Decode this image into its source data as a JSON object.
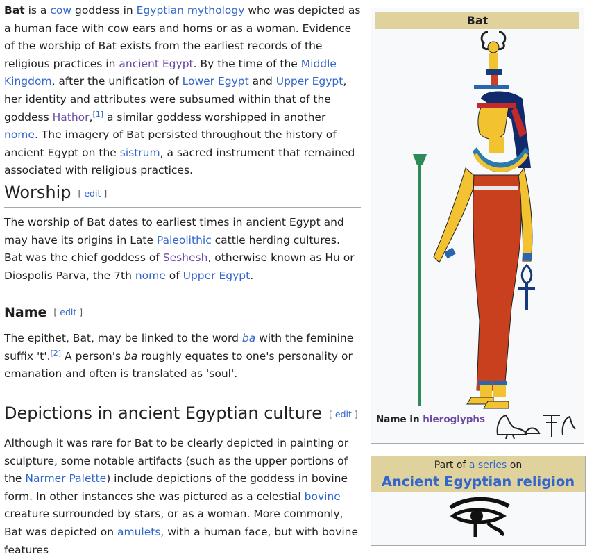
{
  "intro": {
    "t1_bold": "Bat",
    "t2": " is a ",
    "l_cow": "cow",
    "t3": " goddess in ",
    "l_mythology": "Egyptian mythology",
    "t4": " who was depicted as a human face with cow ears and horns or as a woman. Evidence of the worship of Bat exists from the earliest records of the religious practices in ",
    "l_ancient": "ancient Egypt",
    "t5": ". By the time of the ",
    "l_middle": "Middle Kingdom",
    "t6": ", after the unification of ",
    "l_lower": "Lower Egypt",
    "t7": " and ",
    "l_upper": "Upper Egypt",
    "t8": ", her identity and attributes were subsumed within that of the goddess ",
    "l_hathor": "Hathor",
    "t8b": ",",
    "ref1": "[1]",
    "t9": " a similar goddess worshipped in another ",
    "l_nome": "nome",
    "t10": ". The imagery of Bat persisted throughout the history of ancient Egypt on the ",
    "l_sistrum": "sistrum",
    "t11": ", a sacred instrument that remained associated with religious practices."
  },
  "worship": {
    "heading": "Worship",
    "edit_open": "[ ",
    "edit": "edit",
    "edit_close": " ]",
    "t1": "The worship of Bat dates to earliest times in ancient Egypt and may have its origins in Late ",
    "l_paleolithic": "Paleolithic",
    "t2": " cattle herding cultures. Bat was the chief goddess of ",
    "l_seshesh": "Seshesh",
    "t3": ", otherwise known as Hu or Diospolis Parva, the 7th ",
    "l_nome": "nome",
    "t4": " of ",
    "l_upper": "Upper Egypt",
    "t5": "."
  },
  "name": {
    "heading": "Name",
    "edit_open": "[ ",
    "edit": "edit",
    "edit_close": " ]",
    "t1": "The epithet, Bat, may be linked to the word ",
    "l_ba": "ba",
    "t2": " with the feminine suffix 't'.",
    "ref2": "[2]",
    "t3": " A person's ",
    "i_ba": "ba",
    "t4": " roughly equates to one's personality or emanation and often is translated as 'soul'."
  },
  "depictions": {
    "heading": "Depictions in ancient Egyptian culture",
    "edit_open": "[ ",
    "edit": "edit",
    "edit_close": " ]",
    "t1": "Although it was rare for Bat to be clearly depicted in painting or sculpture, some notable artifacts (such as the upper portions of the ",
    "l_narmer": "Narmer Palette",
    "t2": ") include depictions of the goddess in bovine form. In other instances she was pictured as a celestial ",
    "l_bovine": "bovine",
    "t3": " creature surrounded by stars, or as a woman. More commonly, Bat was depicted on ",
    "l_amulets": "amulets",
    "t4": ", with a human face, but with bovine features"
  },
  "infobox": {
    "title": "Bat",
    "hiero_label": "Name in ",
    "hiero_link": "hieroglyphs"
  },
  "series": {
    "part_of": "Part of ",
    "a_series": "a series",
    "on": " on",
    "title": "Ancient Egyptian religion"
  },
  "colors": {
    "link": "#3366cc",
    "visited_link": "#6b4ba1",
    "infobox_header": "#dfd29d",
    "infobox_bg": "#f8f9fa",
    "border": "#a2a9b1"
  }
}
